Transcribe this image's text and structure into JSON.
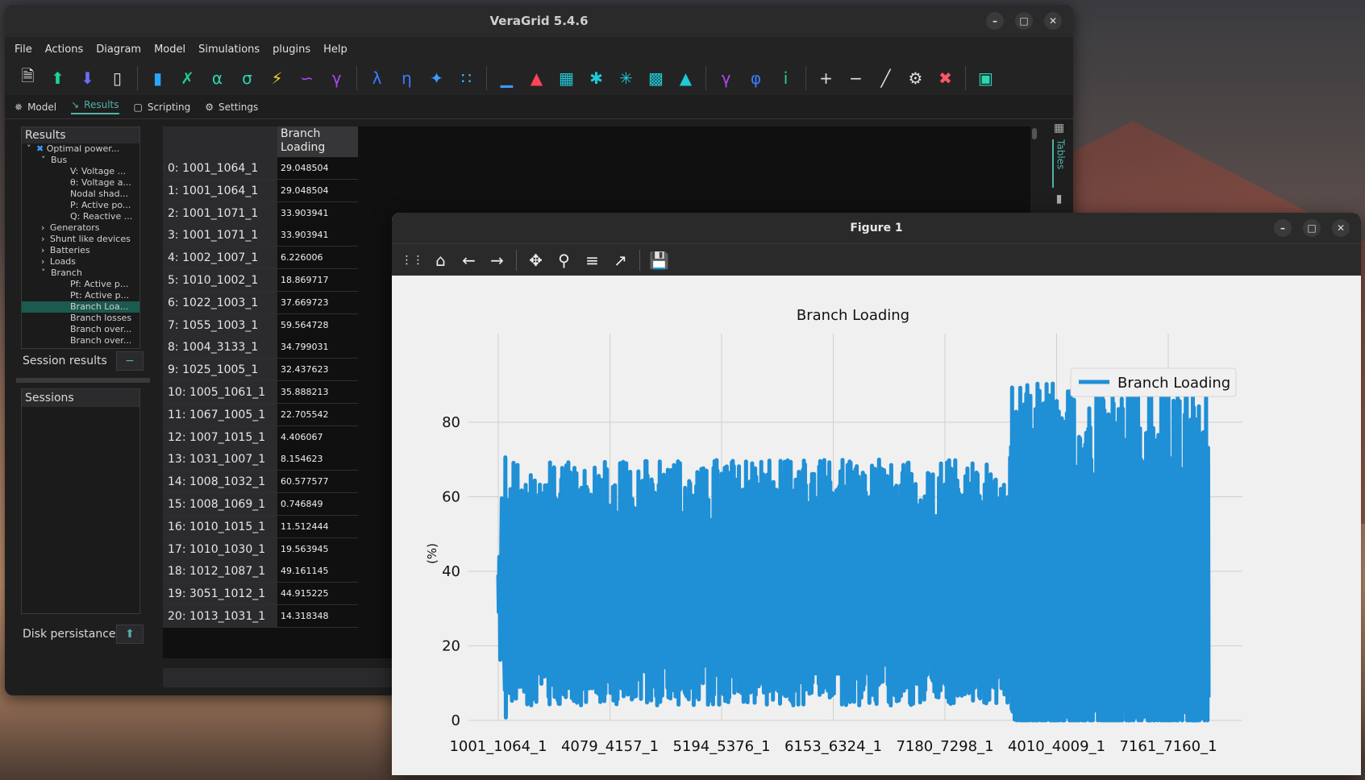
{
  "app": {
    "title": "VeraGrid 5.4.6",
    "menu": [
      "File",
      "Actions",
      "Diagram",
      "Model",
      "Simulations",
      "plugins",
      "Help"
    ],
    "tabs": [
      {
        "label": "Model",
        "icon": "model-icon"
      },
      {
        "label": "Results",
        "icon": "results-icon",
        "active": true
      },
      {
        "label": "Scripting",
        "icon": "scripting-icon"
      },
      {
        "label": "Settings",
        "icon": "gear-icon"
      }
    ],
    "right_tab": "Tables"
  },
  "results_tree": {
    "header": "Results",
    "items": [
      {
        "label": "Optimal power...",
        "indent": 0,
        "arrow": "v",
        "icon": true
      },
      {
        "label": "Bus",
        "indent": 1,
        "arrow": "v"
      },
      {
        "label": "V: Voltage ...",
        "indent": 3
      },
      {
        "label": "θ: Voltage a...",
        "indent": 3
      },
      {
        "label": "Nodal shad...",
        "indent": 3
      },
      {
        "label": "P: Active po...",
        "indent": 3
      },
      {
        "label": "Q: Reactive ...",
        "indent": 3
      },
      {
        "label": "Generators",
        "indent": 1,
        "arrow": ">"
      },
      {
        "label": "Shunt like devices",
        "indent": 1,
        "arrow": ">"
      },
      {
        "label": "Batteries",
        "indent": 1,
        "arrow": ">"
      },
      {
        "label": "Loads",
        "indent": 1,
        "arrow": ">"
      },
      {
        "label": "Branch",
        "indent": 1,
        "arrow": "v"
      },
      {
        "label": "Pf: Active p...",
        "indent": 3
      },
      {
        "label": "Pt: Active p...",
        "indent": 3
      },
      {
        "label": "Branch Loa...",
        "indent": 3,
        "selected": true
      },
      {
        "label": "Branch losses",
        "indent": 3
      },
      {
        "label": "Branch over...",
        "indent": 3
      },
      {
        "label": "Branch over...",
        "indent": 3
      }
    ]
  },
  "session_results": {
    "label": "Session results",
    "button": "−"
  },
  "sessions": {
    "header": "Sessions"
  },
  "disk": {
    "label": "Disk persistance"
  },
  "table": {
    "column": "Branch Loading",
    "rows": [
      {
        "name": "0: 1001_1064_1",
        "value": "29.048504"
      },
      {
        "name": "1: 1001_1064_1",
        "value": "29.048504"
      },
      {
        "name": "2: 1001_1071_1",
        "value": "33.903941"
      },
      {
        "name": "3: 1001_1071_1",
        "value": "33.903941"
      },
      {
        "name": "4: 1002_1007_1",
        "value": "6.226006"
      },
      {
        "name": "5: 1010_1002_1",
        "value": "18.869717"
      },
      {
        "name": "6: 1022_1003_1",
        "value": "37.669723"
      },
      {
        "name": "7: 1055_1003_1",
        "value": "59.564728"
      },
      {
        "name": "8: 1004_3133_1",
        "value": "34.799031"
      },
      {
        "name": "9: 1025_1005_1",
        "value": "32.437623"
      },
      {
        "name": "10: 1005_1061_1",
        "value": "35.888213"
      },
      {
        "name": "11: 1067_1005_1",
        "value": "22.705542"
      },
      {
        "name": "12: 1007_1015_1",
        "value": "4.406067"
      },
      {
        "name": "13: 1031_1007_1",
        "value": "8.154623"
      },
      {
        "name": "14: 1008_1032_1",
        "value": "60.577577"
      },
      {
        "name": "15: 1008_1069_1",
        "value": "0.746849"
      },
      {
        "name": "16: 1010_1015_1",
        "value": "11.512444"
      },
      {
        "name": "17: 1010_1030_1",
        "value": "19.563945"
      },
      {
        "name": "18: 1012_1087_1",
        "value": "49.161145"
      },
      {
        "name": "19: 3051_1012_1",
        "value": "44.915225"
      },
      {
        "name": "20: 1013_1031_1",
        "value": "14.318348"
      }
    ]
  },
  "figure": {
    "title": "Figure 1",
    "toolbar_icons": [
      "drag-handle-icon",
      "home-icon",
      "back-icon",
      "forward-icon",
      "pan-icon",
      "zoom-icon",
      "configure-icon",
      "axes-icon",
      "save-icon"
    ]
  },
  "chart_data": {
    "type": "line",
    "title": "Branch Loading",
    "ylabel": "(%)",
    "xlabel": "",
    "legend": "top-right",
    "grid": true,
    "ylim": [
      0,
      95
    ],
    "yticks": [
      0,
      20,
      40,
      60,
      80
    ],
    "xtick_labels": [
      "1001_1064_1",
      "4079_4157_1",
      "5194_5376_1",
      "6153_6324_1",
      "7180_7298_1",
      "4010_4009_1",
      "7161_7160_1"
    ],
    "series": [
      {
        "name": "Branch Loading",
        "color": "#1f8fd6",
        "values": [
          29.05,
          29.05,
          33.9,
          33.9,
          6.23,
          18.87,
          37.67,
          59.56,
          34.8,
          32.44,
          35.89,
          22.71,
          4.41,
          8.15,
          60.58,
          0.75,
          11.51,
          19.56,
          49.16,
          44.92,
          14.32
        ]
      }
    ]
  }
}
